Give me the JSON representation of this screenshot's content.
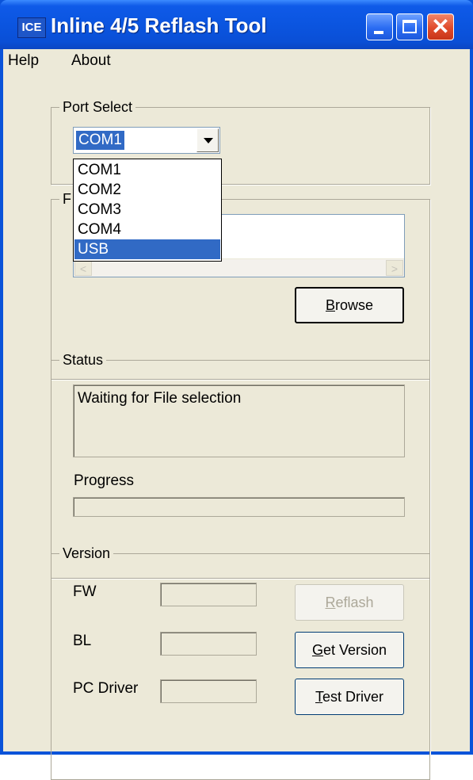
{
  "window": {
    "title": "Inline 4/5  Reflash Tool",
    "icon": "ICE"
  },
  "menu": {
    "help": "Help",
    "about": "About"
  },
  "port_select": {
    "label": "Port Select",
    "selected": "COM1",
    "options": [
      "COM1",
      "COM2",
      "COM3",
      "COM4",
      "USB"
    ],
    "highlighted": "USB"
  },
  "file": {
    "label_visible": "F",
    "browse_prefix": "",
    "browse_underlined": "B",
    "browse_rest": "rowse",
    "scroll_left": "<",
    "scroll_right": ">"
  },
  "status": {
    "label": "Status",
    "message": "Waiting for File selection",
    "progress_label": "Progress",
    "progress_value": 0
  },
  "version": {
    "label": "Version",
    "fw_label": "FW",
    "bl_label": "BL",
    "pc_driver_label": "PC Driver",
    "fw_value": "",
    "bl_value": "",
    "pc_driver_value": "",
    "reflash_underlined": "R",
    "reflash_rest": "eflash",
    "get_version_underlined": "G",
    "get_version_rest": "et Version",
    "test_driver_underlined": "T",
    "test_driver_rest": "est Driver"
  },
  "colors": {
    "titlebar": "#0b55e0",
    "client": "#ece9d8",
    "selection": "#316ac5",
    "close": "#e04a2a"
  }
}
